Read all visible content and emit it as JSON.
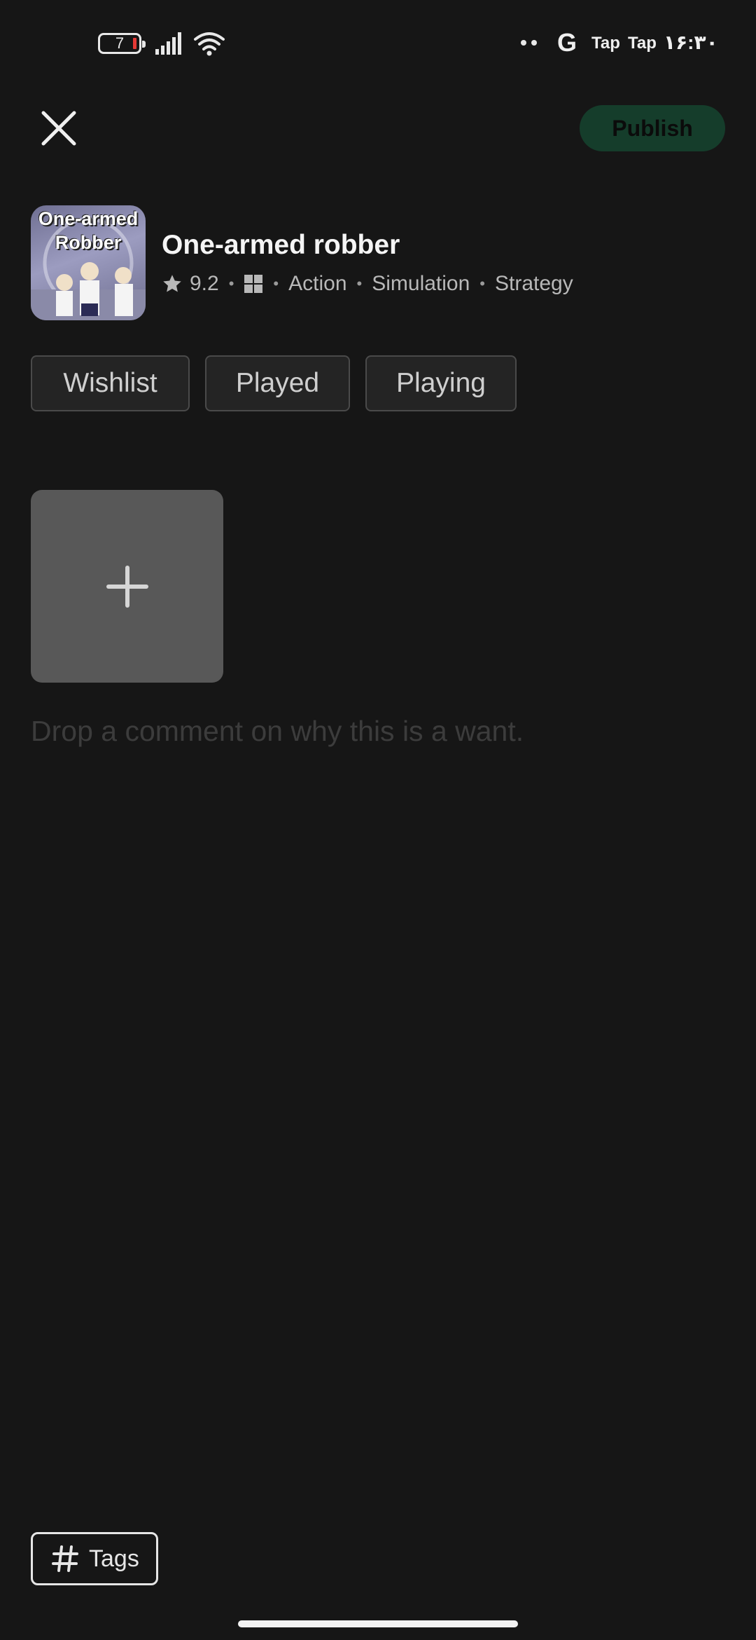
{
  "status_bar": {
    "battery_level": "7",
    "left_icons": [
      "battery-icon",
      "signal-icon",
      "wifi-icon"
    ],
    "notification_icons": [
      "dots-icon",
      "google-icon"
    ],
    "app_label_1": "Tap",
    "app_label_2": "Tap",
    "time": "۱۶:۳۰"
  },
  "top_bar": {
    "close_icon": "close-icon",
    "publish_label": "Publish"
  },
  "game": {
    "cover_title_line1": "One-armed",
    "cover_title_line2": "Robber",
    "title": "One-armed robber",
    "rating": "9.2",
    "platform_icon": "windows-icon",
    "genres": [
      "Action",
      "Simulation",
      "Strategy"
    ]
  },
  "status_options": [
    "Wishlist",
    "Played",
    "Playing"
  ],
  "media": {
    "add_icon": "plus-icon"
  },
  "comment": {
    "placeholder": "Drop a comment on why this is a want."
  },
  "footer": {
    "tags_label": "Tags",
    "tags_icon": "hash-icon"
  },
  "colors": {
    "background": "#161616",
    "publish_bg": "#153d2b",
    "chip_bg": "#242424",
    "add_media_bg": "#585858"
  }
}
